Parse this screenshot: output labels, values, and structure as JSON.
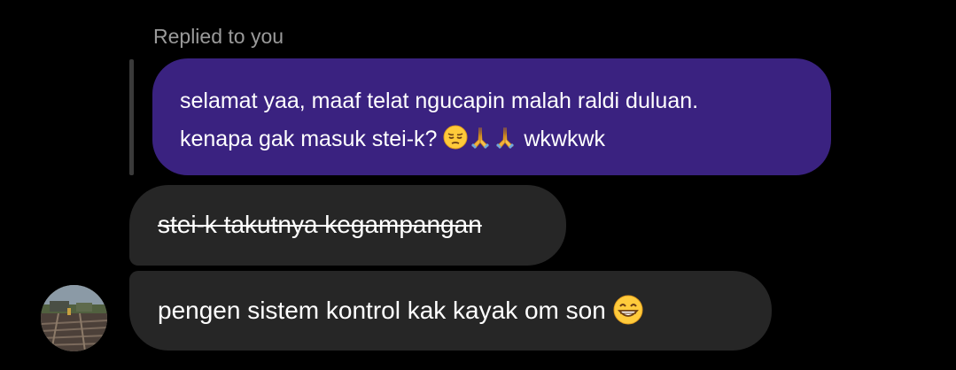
{
  "reply": {
    "label": "Replied to you",
    "quoted_line1": "selamat yaa, maaf telat ngucapin malah raldi duluan.",
    "quoted_line2_text": "kenapa gak masuk stei-k?",
    "quoted_line2_tail": "wkwkwk",
    "quoted_emojis": [
      "pensive-face-icon",
      "folded-hands-icon",
      "folded-hands-icon"
    ]
  },
  "messages": [
    {
      "text": "stei-k takutnya kegampangan",
      "strikethrough": true
    },
    {
      "text": "pengen sistem kontrol kak kayak om son",
      "emoji": "grinning-face-icon"
    }
  ],
  "colors": {
    "background": "#000000",
    "quoted_bubble": "#3a2280",
    "message_bubble": "#262626",
    "label_text": "#9a9a9a",
    "message_text": "#ffffff"
  }
}
